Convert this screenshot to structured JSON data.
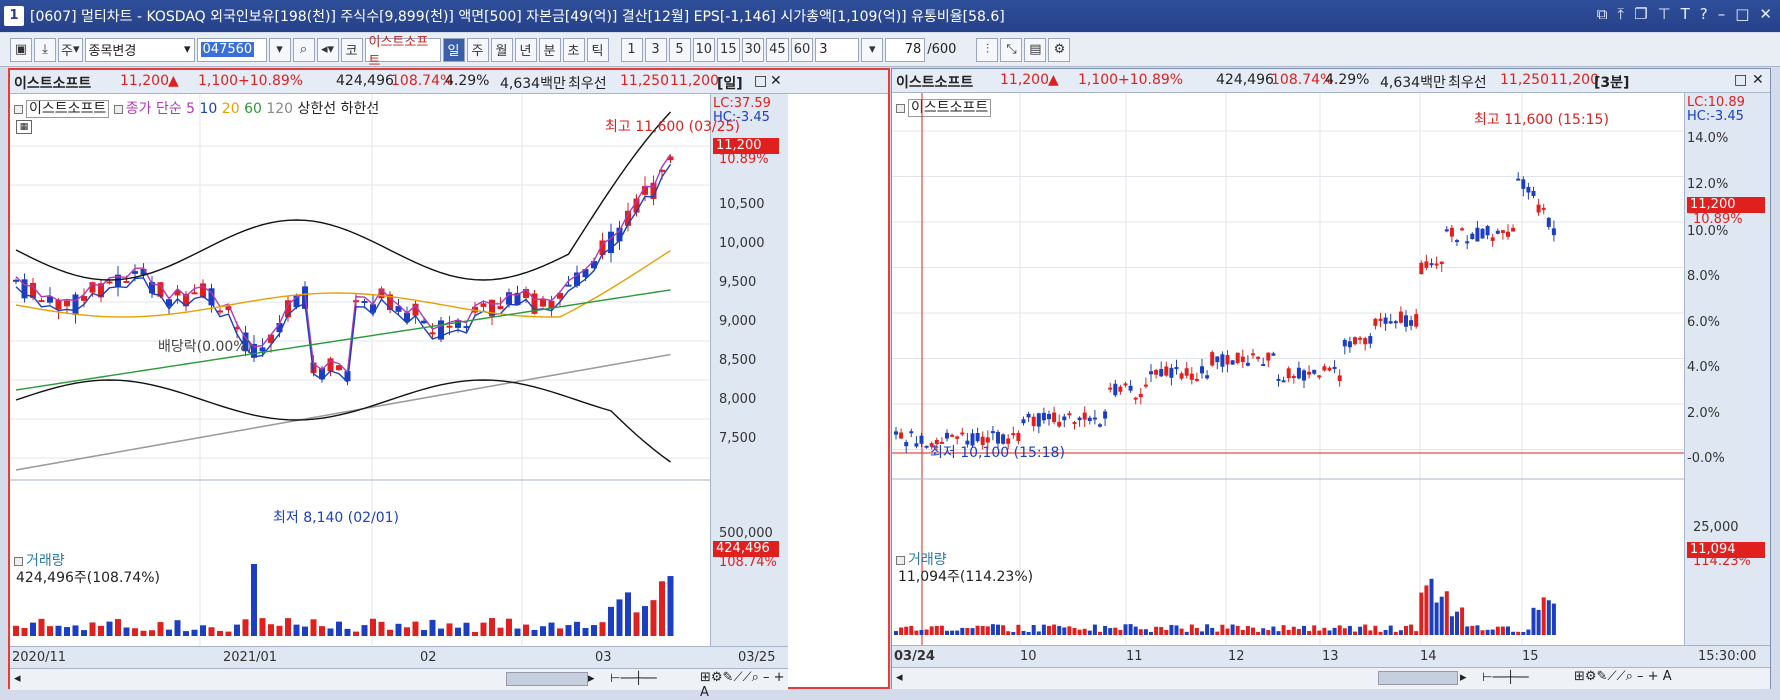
{
  "window": {
    "number": "1",
    "title": "[0607] 멀티차트 - KOSDAQ 외국인보유[198(천)] 주식수[9,899(천)] 액면[500] 자본금[49(억)] 결산[12월] EPS[-1,146] 시가총액[1,109(억)] 유통비율[58.6]"
  },
  "toolbar": {
    "market": "주",
    "change_label": "종목변경",
    "code": "047560",
    "stock_name": "이스트소프트",
    "code_btn": "코",
    "periods": [
      "일",
      "주",
      "월",
      "년",
      "분",
      "초",
      "틱"
    ],
    "selected_period": "일",
    "nums": [
      "1",
      "3",
      "5",
      "10",
      "15",
      "30",
      "45",
      "60"
    ],
    "count_sel": "3",
    "count": "78",
    "count_max": "/600"
  },
  "left": {
    "head": {
      "name": "이스트소프트",
      "price": "11,200",
      "arrow": "▲",
      "change": "1,100",
      "pct": "+10.89%",
      "volume": "424,496",
      "vol_ratio": "108.74%",
      "turnover": "4.29%",
      "amount": "4,634백만",
      "ask_label": "최우선",
      "ask": "11,250",
      "bid": "11,200",
      "period": "[일]"
    },
    "legend": {
      "name": "이스트소프트",
      "ma_label": "종가 단순 5",
      "ma10": "10",
      "ma20": "20",
      "ma60": "60",
      "ma120": "120",
      "upper": "상한선",
      "lower": "하한선"
    },
    "lc": "LC:37.59",
    "hc": "HC:-3.45",
    "price_box": "11,200",
    "price_pct": "10.89%",
    "yticks": [
      "10,500",
      "10,000",
      "9,500",
      "9,000",
      "8,500",
      "8,000",
      "7,500"
    ],
    "high_ann": "최고 11,600 (03/25)",
    "low_ann": "최저 8,140 (02/01)",
    "div_ann": "배당락(0.00%)",
    "vol_title": "거래량",
    "vol_value": "424,496주(108.74%)",
    "vol_tick": "500,000",
    "vol_box": "424,496",
    "vol_pct": "108.74%",
    "xticks": [
      "2020/11",
      "2021/01",
      "02",
      "03"
    ],
    "xend": "03/25"
  },
  "right": {
    "head": {
      "name": "이스트소프트",
      "price": "11,200",
      "arrow": "▲",
      "change": "1,100",
      "pct": "+10.89%",
      "volume": "424,496",
      "vol_ratio": "108.74%",
      "turnover": "4.29%",
      "amount": "4,634백만",
      "ask_label": "최우선",
      "ask": "11,250",
      "bid": "11,200",
      "period": "[3분]"
    },
    "legend": {
      "name": "이스트소프트"
    },
    "lc": "LC:10.89",
    "hc": "HC:-3.45",
    "price_box": "11,200",
    "price_pct": "10.89%",
    "yticks": [
      "14.0%",
      "12.0%",
      "10.0%",
      "8.0%",
      "6.0%",
      "4.0%",
      "2.0%",
      "-0.0%"
    ],
    "high_ann": "최고 11,600 (15:15)",
    "low_ann": "최저 10,100 (15:18)",
    "vol_title": "거래량",
    "vol_value": "11,094주(114.23%)",
    "vol_tick": "25,000",
    "vol_box": "11,094",
    "vol_pct": "114.23%",
    "xticks": [
      "03/24",
      "10",
      "11",
      "12",
      "13",
      "14",
      "15"
    ],
    "xend": "15:30:00"
  },
  "colors": {
    "up": "#e0201e",
    "down": "#1b3fc0",
    "frame": "#26418a"
  }
}
